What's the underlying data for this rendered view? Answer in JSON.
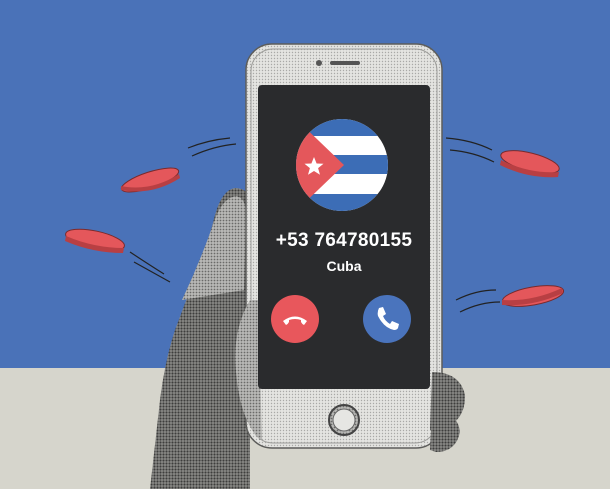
{
  "incoming_call": {
    "number": "+53 764780155",
    "country": "Cuba"
  },
  "icons": {
    "decline": "phone-hangup-icon",
    "accept": "phone-answer-icon",
    "flag": "cuba-flag-icon"
  },
  "colors": {
    "background_blue": "#4a72b8",
    "ground": "#d6d5cc",
    "screen": "#2a2b2d",
    "phone_body": "#e6e6e3",
    "decline": "#e8575c",
    "accept": "#4a74bd",
    "coin": "#e4575b",
    "flag_blue": "#3c6db6",
    "flag_red": "#e4575b"
  }
}
